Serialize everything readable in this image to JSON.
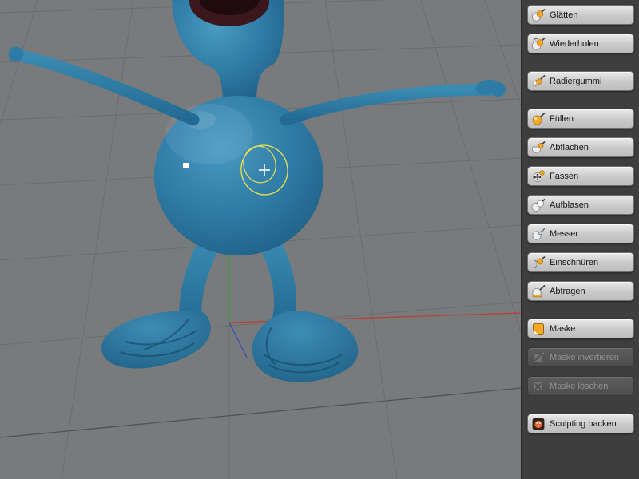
{
  "panel": {
    "tools": [
      {
        "label": "Glätten",
        "icon": "smooth-brush-icon",
        "enabled": true
      },
      {
        "label": "Wiederholen",
        "icon": "repeat-brush-icon",
        "enabled": true
      },
      {
        "label": "Radiergummi",
        "icon": "erase-brush-icon",
        "enabled": true
      },
      {
        "label": "Füllen",
        "icon": "fill-brush-icon",
        "enabled": true
      },
      {
        "label": "Abflachen",
        "icon": "flatten-brush-icon",
        "enabled": true
      },
      {
        "label": "Fassen",
        "icon": "grab-brush-icon",
        "enabled": true
      },
      {
        "label": "Aufblasen",
        "icon": "inflate-brush-icon",
        "enabled": true
      },
      {
        "label": "Messer",
        "icon": "knife-brush-icon",
        "enabled": true
      },
      {
        "label": "Einschnüren",
        "icon": "pinch-brush-icon",
        "enabled": true
      },
      {
        "label": "Abtragen",
        "icon": "scrape-brush-icon",
        "enabled": true
      },
      {
        "label": "Maske",
        "icon": "mask-icon",
        "enabled": true
      },
      {
        "label": "Maske invertieren",
        "icon": "mask-invert-icon",
        "enabled": false
      },
      {
        "label": "Maske löschen",
        "icon": "mask-delete-icon",
        "enabled": false
      },
      {
        "label": "Sculpting backen",
        "icon": "bake-sculpting-icon",
        "enabled": true
      }
    ]
  },
  "viewport": {
    "colors": {
      "background": "#797a7c",
      "grid_line": "#6b6c6e",
      "model": "#2e7ba6",
      "axis_x": "#b8412f",
      "axis_y": "#3f9a3f",
      "axis_z": "#3c49b4",
      "brush_cursor": "#e3dd55"
    }
  }
}
